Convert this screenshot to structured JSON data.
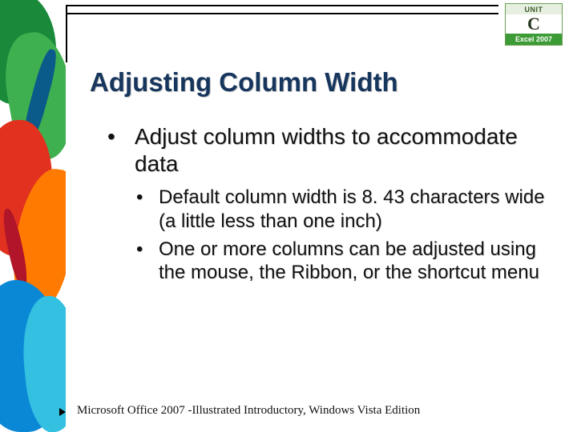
{
  "badge": {
    "unit_label": "UNIT",
    "unit_letter": "C",
    "product": "Excel 2007"
  },
  "title": "Adjusting Column Width",
  "bullets": {
    "level1_item1": "Adjust column widths to accommodate data",
    "level2_item1": "Default column width is 8. 43 characters wide (a little less than one inch)",
    "level2_item2": "One or more columns can be adjusted using the mouse, the Ribbon, or the shortcut menu"
  },
  "footer": "Microsoft Office 2007 -Illustrated Introductory, Windows Vista Edition"
}
